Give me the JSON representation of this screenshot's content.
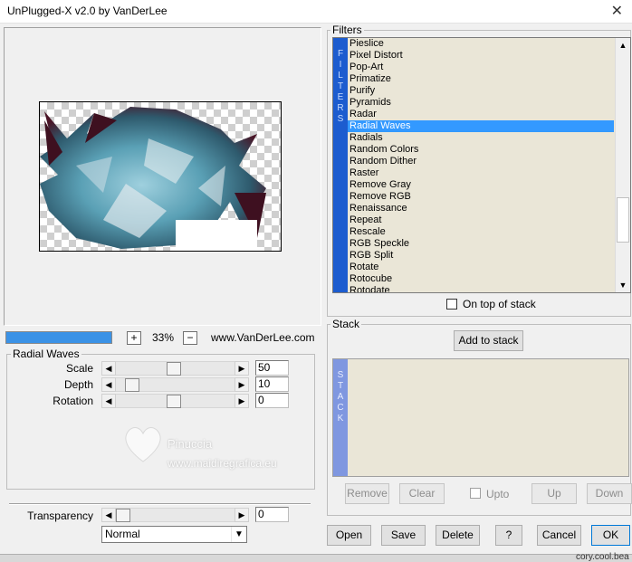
{
  "window": {
    "title": "UnPlugged-X v2.0 by VanDerLee",
    "close_label": "✕"
  },
  "preview": {
    "zoom": "33%",
    "website": "www.VanDerLee.com",
    "zoom_in_label": "+",
    "zoom_out_label": "−",
    "progress": 1.0
  },
  "effect": {
    "group_title": "Radial Waves",
    "sliders": [
      {
        "label": "Scale",
        "value": "50"
      },
      {
        "label": "Depth",
        "value": "10"
      },
      {
        "label": "Rotation",
        "value": "0"
      }
    ]
  },
  "blend": {
    "transparency_label": "Transparency",
    "transparency_value": "0",
    "mode": "Normal"
  },
  "filters": {
    "group_title": "Filters",
    "side_label": [
      "F",
      "I",
      "L",
      "T",
      "E",
      "R",
      "S"
    ],
    "items": [
      "Pieslice",
      "Pixel Distort",
      "Pop-Art",
      "Primatize",
      "Purify",
      "Pyramids",
      "Radar",
      "Radial Waves",
      "Radials",
      "Random Colors",
      "Random Dither",
      "Raster",
      "Remove Gray",
      "Remove RGB",
      "Renaissance",
      "Repeat",
      "Rescale",
      "RGB Speckle",
      "RGB Split",
      "Rotate",
      "Rotocube",
      "Rotodate"
    ],
    "selected": "Radial Waves",
    "on_top_label": "On top of stack"
  },
  "stack": {
    "group_title": "Stack",
    "add_label": "Add to stack",
    "side_label": [
      "S",
      "T",
      "A",
      "C",
      "K"
    ],
    "remove_label": "Remove",
    "clear_label": "Clear",
    "upto_label": "Upto",
    "up_label": "Up",
    "down_label": "Down"
  },
  "footer": {
    "open": "Open",
    "save": "Save",
    "delete": "Delete",
    "help": "?",
    "cancel": "Cancel",
    "ok": "OK"
  },
  "watermark": {
    "line1": "Pinuccia",
    "line2": "www.maidiregrafica.eu"
  },
  "taskbar_hint": "cory.cool.bea"
}
